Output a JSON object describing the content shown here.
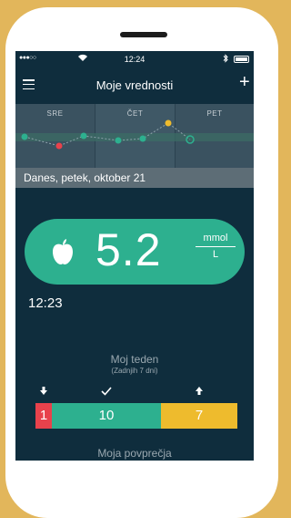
{
  "status_bar": {
    "carrier": "●●●○○",
    "time": "12:24"
  },
  "nav": {
    "title": "Moje vrednosti"
  },
  "week_strip": {
    "days": [
      "SRE",
      "ČET",
      "PET"
    ],
    "points": [
      {
        "day": "SRE",
        "status": "normal",
        "color": "#2db08f"
      },
      {
        "day": "SRE",
        "status": "low",
        "color": "#e8424c"
      },
      {
        "day": "ČET",
        "status": "normal",
        "color": "#2db08f"
      },
      {
        "day": "ČET",
        "status": "normal",
        "color": "#2db08f"
      },
      {
        "day": "ČET",
        "status": "normal",
        "color": "#2db08f"
      },
      {
        "day": "PET",
        "status": "high",
        "color": "#eebb2d"
      },
      {
        "day": "PET",
        "status": "normal-selected",
        "color": "#2db08f"
      }
    ]
  },
  "date_header": "Danes, petek, oktober 21",
  "reading": {
    "value": "5.2",
    "unit_top": "mmol",
    "unit_bottom": "L",
    "icon": "apple-icon",
    "time": "12:23"
  },
  "my_week": {
    "title": "Moj teden",
    "subtitle": "(Zadnjih 7 dni)",
    "low": "1",
    "normal": "10",
    "high": "7"
  },
  "averages": {
    "title": "Moja povprečja"
  },
  "colors": {
    "background": "#0f2d3d",
    "normal": "#2db08f",
    "low": "#e8424c",
    "high": "#eebb2d",
    "frame": "#e2b65b"
  }
}
